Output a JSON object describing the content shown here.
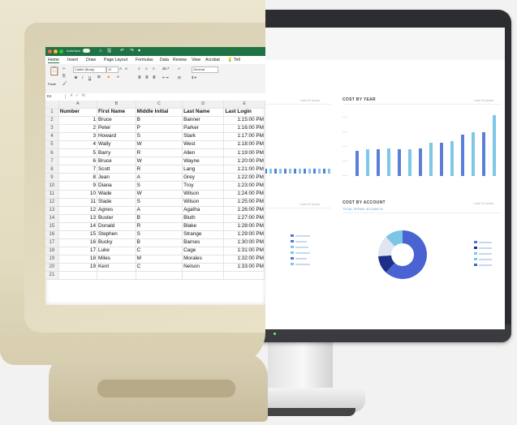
{
  "excel": {
    "autosave_label": "AutoSave",
    "toggle_state": "OFF",
    "quick_access": [
      "⌂",
      "🖫",
      "↶",
      "↷",
      "▾"
    ],
    "tabs": [
      "Home",
      "Insert",
      "Draw",
      "Page Layout",
      "Formulas",
      "Data",
      "Review",
      "View",
      "Acrobat",
      "Tell"
    ],
    "active_tab": "Home",
    "ribbon": {
      "paste_label": "Paste",
      "font_name": "Calibri (Body)",
      "font_size": "12",
      "number_format": "General",
      "bold": "B",
      "italic": "I",
      "underline": "U"
    },
    "name_box": "E4",
    "formula_fx": "fx",
    "columns": [
      "A",
      "B",
      "C",
      "D",
      "E"
    ],
    "headers": [
      "Number",
      "First Name",
      "Middle Initial",
      "Last Name",
      "Last Login"
    ],
    "rows": [
      {
        "n": "1",
        "first": "Bruce",
        "mid": "B",
        "last": "Banner",
        "login": "1:15:00 PM"
      },
      {
        "n": "2",
        "first": "Peter",
        "mid": "P",
        "last": "Parker",
        "login": "1:16:00 PM"
      },
      {
        "n": "3",
        "first": "Howard",
        "mid": "S",
        "last": "Stark",
        "login": "1:17:00 PM"
      },
      {
        "n": "4",
        "first": "Wally",
        "mid": "W",
        "last": "West",
        "login": "1:18:00 PM"
      },
      {
        "n": "5",
        "first": "Barry",
        "mid": "R",
        "last": "Allen",
        "login": "1:19:00 PM"
      },
      {
        "n": "6",
        "first": "Bruce",
        "mid": "W",
        "last": "Wayne",
        "login": "1:20:00 PM"
      },
      {
        "n": "7",
        "first": "Scott",
        "mid": "R",
        "last": "Lang",
        "login": "1:21:00 PM"
      },
      {
        "n": "8",
        "first": "Jean",
        "mid": "A",
        "last": "Grey",
        "login": "1:22:00 PM"
      },
      {
        "n": "9",
        "first": "Diana",
        "mid": "S",
        "last": "Troy",
        "login": "1:23:00 PM"
      },
      {
        "n": "10",
        "first": "Wade",
        "mid": "W",
        "last": "Wilson",
        "login": "1:24:00 PM"
      },
      {
        "n": "11",
        "first": "Slade",
        "mid": "S",
        "last": "Wilson",
        "login": "1:25:00 PM"
      },
      {
        "n": "12",
        "first": "Agnes",
        "mid": "A",
        "last": "Agatha",
        "login": "1:26:00 PM"
      },
      {
        "n": "13",
        "first": "Buster",
        "mid": "B",
        "last": "Bluth",
        "login": "1:27:00 PM"
      },
      {
        "n": "14",
        "first": "Donald",
        "mid": "R",
        "last": "Blake",
        "login": "1:28:00 PM"
      },
      {
        "n": "15",
        "first": "Stephen",
        "mid": "S",
        "last": "Strange",
        "login": "1:29:00 PM"
      },
      {
        "n": "16",
        "first": "Bucky",
        "mid": "B",
        "last": "Barnes",
        "login": "1:30:00 PM"
      },
      {
        "n": "17",
        "first": "Luke",
        "mid": "C",
        "last": "Cage",
        "login": "1:31:00 PM"
      },
      {
        "n": "18",
        "first": "Miles",
        "mid": "M",
        "last": "Morales",
        "login": "1:32:00 PM"
      },
      {
        "n": "19",
        "first": "Kent",
        "mid": "C",
        "last": "Nelson",
        "login": "1:33:00 PM"
      }
    ]
  },
  "dashboard": {
    "cost_by_year": {
      "title": "COST BY YEAR",
      "right_label": "Last 10 years",
      "bar_values": [
        0.42,
        0.44,
        0.44,
        0.45,
        0.44,
        0.44,
        0.45,
        0.55,
        0.55,
        0.58,
        0.68,
        0.72,
        0.72,
        1.0
      ],
      "bar_colors": [
        "#5b7fd8",
        "#7dc8e6"
      ]
    },
    "cost_by_account": {
      "title": "COST BY ACCOUNT",
      "subtitle": "TOTAL SPEND: $74,589.78",
      "donut": [
        {
          "value": 62,
          "color": "#4a63d2"
        },
        {
          "value": 12,
          "color": "#1e2f88"
        },
        {
          "value": 14,
          "color": "#dfe6f0"
        },
        {
          "value": 12,
          "color": "#7bc6e4"
        }
      ]
    },
    "left_panel_right_label": "Last 10 years",
    "small_bars": [
      0.6,
      0.6,
      0.6,
      0.6,
      0.6,
      0.6,
      0.6,
      0.6,
      0.6,
      0.6,
      0.6,
      0.6,
      0.6,
      0.6
    ],
    "colors": {
      "accent": "#5b7fd8",
      "light": "#7dc8e6",
      "excel_green": "#1f7244"
    }
  }
}
